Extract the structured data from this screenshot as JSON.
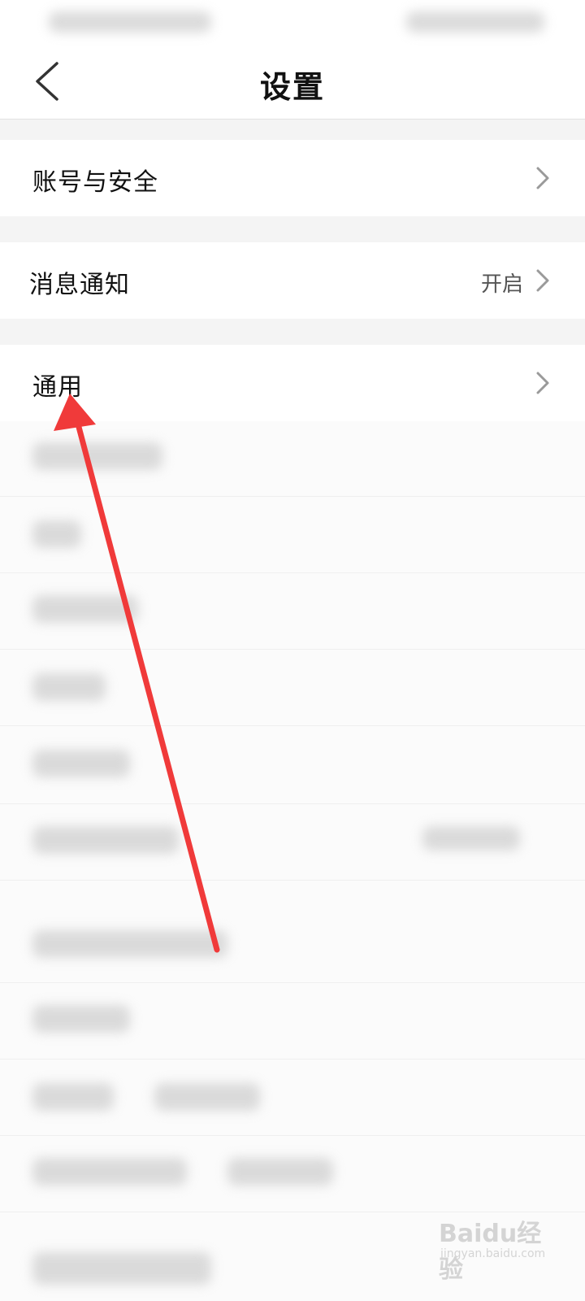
{
  "header": {
    "title": "设置"
  },
  "settings": [
    {
      "label": "账号与安全",
      "value": ""
    },
    {
      "label": "消息通知",
      "value": "开启"
    },
    {
      "label": "通用",
      "value": ""
    }
  ],
  "watermark": {
    "brand": "Baidu经验",
    "url": "jingyan.baidu.com"
  },
  "colors": {
    "annotation_arrow": "#f03a3a",
    "background": "#f4f4f4",
    "card": "#ffffff"
  }
}
